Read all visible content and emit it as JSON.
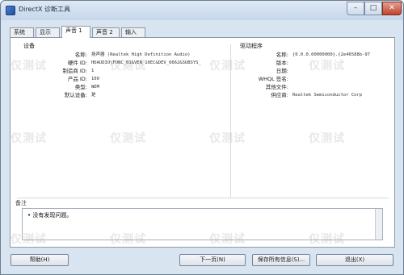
{
  "window": {
    "title": "DirectX 诊断工具",
    "minimize_glyph": "–",
    "maximize_glyph": "□",
    "close_glyph": "✕"
  },
  "tabs": [
    {
      "label": "系统"
    },
    {
      "label": "显示"
    },
    {
      "label": "声音 1"
    },
    {
      "label": "声音 2"
    },
    {
      "label": "输入"
    }
  ],
  "device": {
    "section_title": "设备",
    "rows": [
      {
        "label": "名称:",
        "value": "扬声器 (Realtek High Definition Audio)"
      },
      {
        "label": "硬件 ID:",
        "value": "HDAUDIO\\FUNC_01&VEN_10EC&DEV_0662&SUBSYS_"
      },
      {
        "label": "制造商 ID:",
        "value": "1"
      },
      {
        "label": "产品 ID:",
        "value": "100"
      },
      {
        "label": "类型:",
        "value": "WDM"
      },
      {
        "label": "默认设备:",
        "value": "是"
      }
    ]
  },
  "driver": {
    "section_title": "驱动程序",
    "rows": [
      {
        "label": "名称:",
        "value": "{0.0.0.00000000}.{2e46588b-97"
      },
      {
        "label": "版本:",
        "value": ""
      },
      {
        "label": "日期:",
        "value": ""
      },
      {
        "label": "WHQL 签名:",
        "value": ""
      },
      {
        "label": "其他文件:",
        "value": ""
      },
      {
        "label": "供应商:",
        "value": "Realtek Semiconductor Corp"
      }
    ]
  },
  "notes": {
    "title": "备注",
    "items": [
      "没有发现问题。"
    ]
  },
  "buttons": {
    "help": "帮助(H)",
    "next": "下一页(N)",
    "save": "保存所有信息(S)...",
    "exit": "退出(X)"
  },
  "watermark": "仅测试"
}
